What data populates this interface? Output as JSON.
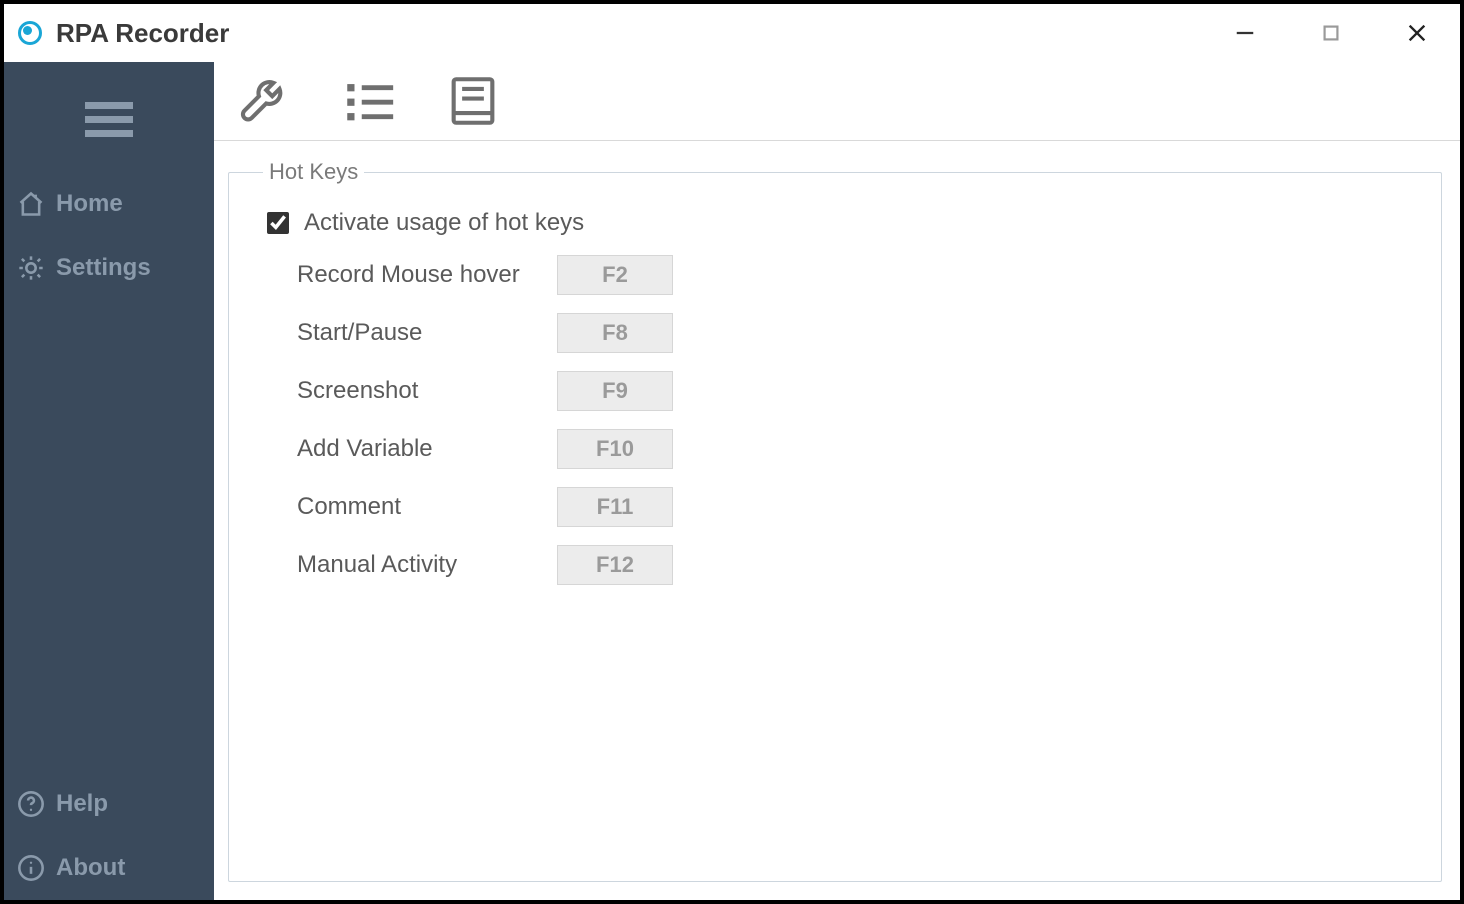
{
  "window": {
    "title": "RPA Recorder"
  },
  "sidebar": {
    "items": [
      {
        "id": "home",
        "label": "Home"
      },
      {
        "id": "settings",
        "label": "Settings"
      },
      {
        "id": "help",
        "label": "Help"
      },
      {
        "id": "about",
        "label": "About"
      }
    ]
  },
  "toolbar": {
    "items": [
      {
        "id": "wrench",
        "name": "settings-general"
      },
      {
        "id": "list",
        "name": "settings-list"
      },
      {
        "id": "book",
        "name": "settings-docs"
      }
    ]
  },
  "hotkeys": {
    "group_title": "Hot Keys",
    "activate_label": "Activate usage of hot keys",
    "activate_checked": true,
    "rows": [
      {
        "label": "Record Mouse hover",
        "key": "F2"
      },
      {
        "label": "Start/Pause",
        "key": "F8"
      },
      {
        "label": "Screenshot",
        "key": "F9"
      },
      {
        "label": "Add Variable",
        "key": "F10"
      },
      {
        "label": "Comment",
        "key": "F11"
      },
      {
        "label": "Manual Activity",
        "key": "F12"
      }
    ]
  }
}
